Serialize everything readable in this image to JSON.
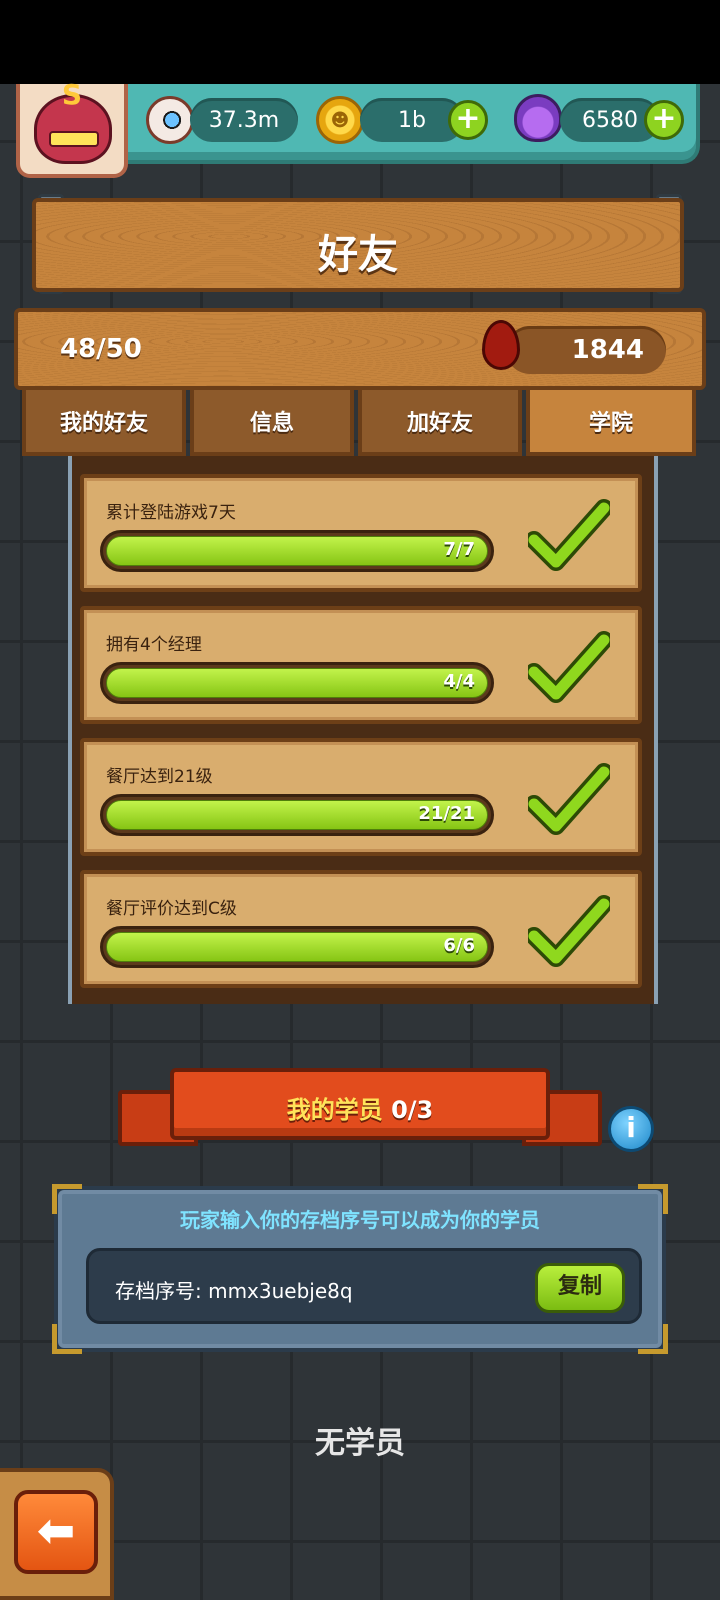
{
  "resources": {
    "eyes": "37.3m",
    "coins": "1b",
    "potions": "6580",
    "coin_symbol": "☻"
  },
  "avatar": {
    "badge": "S"
  },
  "header": {
    "title": "好友"
  },
  "friends": {
    "count": "48/50",
    "blood": "1844"
  },
  "tabs": [
    {
      "label": "我的好友",
      "active": false
    },
    {
      "label": "信息",
      "active": false
    },
    {
      "label": "加好友",
      "active": false
    },
    {
      "label": "学院",
      "active": true
    }
  ],
  "tasks": [
    {
      "title": "累计登陆游戏7天",
      "progress": "7/7",
      "fraction": 1.0,
      "done": true
    },
    {
      "title": "拥有4个经理",
      "progress": "4/4",
      "fraction": 1.0,
      "done": true
    },
    {
      "title": "餐厅达到21级",
      "progress": "21/21",
      "fraction": 1.0,
      "done": true
    },
    {
      "title": "餐厅评价达到C级",
      "progress": "6/6",
      "fraction": 1.0,
      "done": true
    }
  ],
  "students": {
    "title": "我的学员",
    "count": "0/3",
    "info_icon": "i",
    "invite_text": "玩家输入你的存档序号可以成为你的学员",
    "code_label": "存档序号: mmx3uebje8q",
    "copy_label": "复制",
    "empty_text": "无学员"
  },
  "back": {
    "icon": "⬅"
  },
  "colors": {
    "progress_green": "#9ad920",
    "wood": "#c6843d",
    "ribbon": "#e24c1d",
    "panel": "#5e7a93"
  }
}
